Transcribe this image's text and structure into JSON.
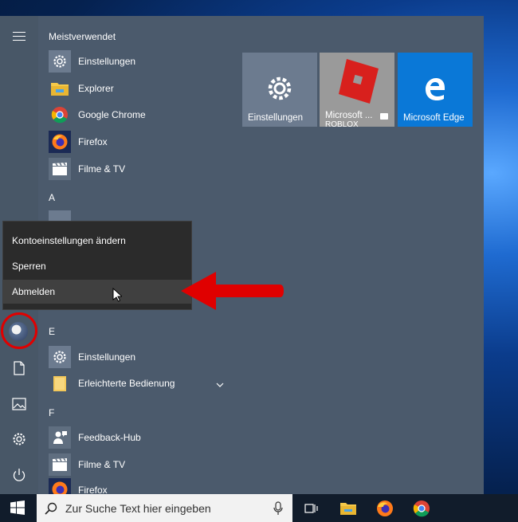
{
  "most_used": {
    "header": "Meistverwendet",
    "items": [
      {
        "label": "Einstellungen",
        "icon": "gear-icon"
      },
      {
        "label": "Explorer",
        "icon": "folder-icon"
      },
      {
        "label": "Google Chrome",
        "icon": "chrome-icon"
      },
      {
        "label": "Firefox",
        "icon": "firefox-icon"
      },
      {
        "label": "Filme & TV",
        "icon": "film-icon"
      }
    ]
  },
  "section_a": {
    "letter": "A"
  },
  "section_e": {
    "letter": "E",
    "items": [
      {
        "label": "Einstellungen",
        "icon": "gear-icon"
      },
      {
        "label": "Erleichterte Bedienung",
        "icon": "folder-icon"
      }
    ]
  },
  "section_f": {
    "letter": "F",
    "items": [
      {
        "label": "Feedback-Hub",
        "icon": "feedback-icon"
      },
      {
        "label": "Filme & TV",
        "icon": "film-icon"
      },
      {
        "label": "Firefox",
        "icon": "firefox-icon"
      }
    ]
  },
  "tiles": [
    {
      "label": "Einstellungen",
      "color": "#6c7b8f"
    },
    {
      "label": "Microsoft ...",
      "sub": "ROBLOX",
      "color": "#9a9a9a"
    },
    {
      "label": "Microsoft Edge",
      "color": "#0a78d7"
    }
  ],
  "account_menu": {
    "items": [
      "Kontoeinstellungen ändern",
      "Sperren",
      "Abmelden"
    ],
    "highlighted": "Abmelden"
  },
  "taskbar": {
    "search_placeholder": "Zur Suche Text hier eingeben"
  },
  "colors": {
    "start_bg": "#4b5a6c",
    "annotation_red": "#e00000",
    "edge_blue": "#0a78d7"
  }
}
